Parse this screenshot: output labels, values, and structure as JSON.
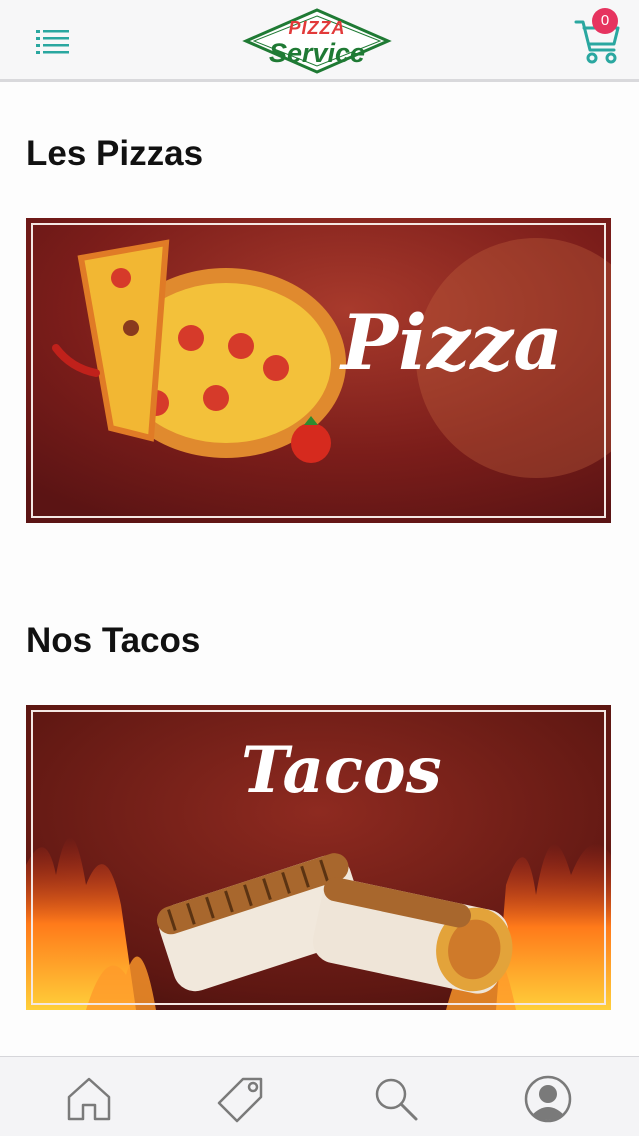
{
  "header": {
    "logo_top": "PIZZA",
    "logo_main": "Service",
    "cart_count": "0"
  },
  "sections": [
    {
      "title": "Les Pizzas",
      "banner_word": "Pizza"
    },
    {
      "title": "Nos Tacos",
      "banner_word": "Tacos"
    }
  ],
  "bottom_nav": {
    "items": [
      "home-icon",
      "tag-icon",
      "search-icon",
      "profile-icon"
    ]
  },
  "colors": {
    "accent": "#2aa7a0",
    "badge": "#e6335f",
    "banner_red": "#7a1a1a"
  }
}
